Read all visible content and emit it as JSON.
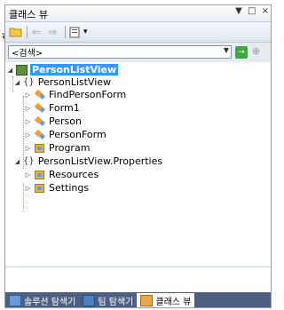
{
  "window": {
    "title": "클래스 뷰",
    "stray_text": "ㅎ"
  },
  "titlebar_controls": {
    "pin": "▼",
    "maximize": "□",
    "close": "×"
  },
  "toolbar": {
    "new_folder_icon": "folder-add-icon",
    "back_icon": "back-arrow-icon",
    "forward_icon": "forward-arrow-icon",
    "settings_icon": "settings-icon",
    "dropdown_glyph": "▾"
  },
  "search": {
    "value": "<검색>",
    "go_label": "→",
    "more_label": "⊕"
  },
  "tree": {
    "root": "PersonListView",
    "ns1": "PersonListView",
    "items_ns1": [
      "FindPersonForm",
      "Form1",
      "Person",
      "PersonForm",
      "Program"
    ],
    "ns2": "PersonListView.Properties",
    "items_ns2": [
      "Resources",
      "Settings"
    ]
  },
  "tabs": [
    "솔루션 탐색기",
    "팀 탐색기",
    "클래스 뷰"
  ],
  "colors": {
    "selection": "#3399ff",
    "tab_bar": "#4d6082"
  }
}
